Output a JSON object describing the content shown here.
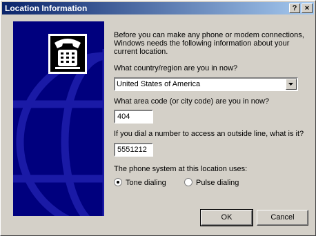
{
  "window": {
    "title": "Location Information",
    "help_label": "?",
    "close_label": "×"
  },
  "intro_text": "Before you can make any phone or modem connections, Windows needs the following information about your current location.",
  "country": {
    "label": "What country/region are you in now?",
    "value": "United States of America"
  },
  "area_code": {
    "label": "What area code (or city code) are you in now?",
    "value": "404"
  },
  "outside_line": {
    "label": "If you dial a number to access an outside line, what is it?",
    "value": "5551212"
  },
  "phone_system": {
    "label": "The phone system at this location uses:",
    "tone_label": "Tone dialing",
    "pulse_label": "Pulse dialing",
    "selected": "Tone dialing"
  },
  "buttons": {
    "ok_label": "OK",
    "cancel_label": "Cancel"
  },
  "icons": {
    "telephone": "telephone-icon",
    "globe": "globe-graphic",
    "dropdown": "chevron-down-icon"
  }
}
